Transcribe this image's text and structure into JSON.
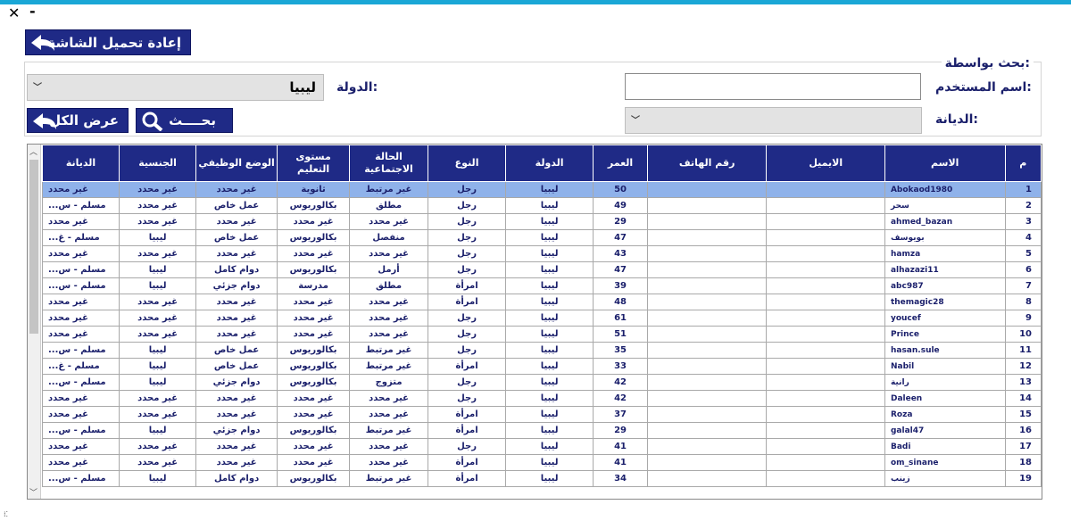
{
  "window": {
    "close_glyph": "✕",
    "minimize_glyph": "-"
  },
  "toolbar": {
    "reload_label": "إعادة تحميل الشاشة",
    "reload_icon": "back-arrow-icon"
  },
  "search": {
    "group_title": "بحث بواسطة:",
    "username_label": "اسم المستخدم:",
    "username_value": "",
    "country_label": "الدولة:",
    "country_value": "ليبيا",
    "religion_label": "الديانة:",
    "religion_value": "",
    "search_button": "بحــــث",
    "search_icon": "magnifier-icon",
    "show_all_button": "عرض الكل",
    "show_all_icon": "back-arrow-icon"
  },
  "grid": {
    "columns": [
      "م",
      "الاسم",
      "الايميل",
      "رقم الهاتف",
      "العمر",
      "الدولة",
      "النوع",
      "الحالة الاجتماعية",
      "مستوى التعليم",
      "الوضع الوظيفي",
      "الجنسية",
      "الديانة"
    ],
    "rows": [
      [
        "1",
        "Abokaod1980",
        "",
        "",
        "50",
        "ليبيا",
        "رجل",
        "غير مرتبط",
        "ثانوية",
        "غير محدد",
        "غير محدد",
        "غير محدد"
      ],
      [
        "2",
        "سحر",
        "",
        "",
        "49",
        "ليبيا",
        "رجل",
        "مطلق",
        "بكالوريوس",
        "عمل خاص",
        "غير محدد",
        "مسلم - س..."
      ],
      [
        "3",
        "ahmed_bazan",
        "",
        "",
        "29",
        "ليبيا",
        "رجل",
        "غير محدد",
        "غير محدد",
        "غير محدد",
        "غير محدد",
        "غير محدد"
      ],
      [
        "4",
        "بويوسف",
        "",
        "",
        "47",
        "ليبيا",
        "رجل",
        "منفصل",
        "بكالوريوس",
        "عمل خاص",
        "ليبيا",
        "مسلم - غ..."
      ],
      [
        "5",
        "hamza",
        "",
        "",
        "43",
        "ليبيا",
        "رجل",
        "غير محدد",
        "غير محدد",
        "غير محدد",
        "غير محدد",
        "غير محدد"
      ],
      [
        "6",
        "alhazazi11",
        "",
        "",
        "47",
        "ليبيا",
        "رجل",
        "أرمل",
        "بكالوريوس",
        "دوام كامل",
        "ليبيا",
        "مسلم - س..."
      ],
      [
        "7",
        "abc987",
        "",
        "",
        "39",
        "ليبيا",
        "امرأة",
        "مطلق",
        "مدرسة",
        "دوام جزئي",
        "ليبيا",
        "مسلم - س..."
      ],
      [
        "8",
        "themagic28",
        "",
        "",
        "48",
        "ليبيا",
        "امرأة",
        "غير محدد",
        "غير محدد",
        "غير محدد",
        "غير محدد",
        "غير محدد"
      ],
      [
        "9",
        "youcef",
        "",
        "",
        "61",
        "ليبيا",
        "رجل",
        "غير محدد",
        "غير محدد",
        "غير محدد",
        "غير محدد",
        "غير محدد"
      ],
      [
        "10",
        "Prince",
        "",
        "",
        "51",
        "ليبيا",
        "رجل",
        "غير محدد",
        "غير محدد",
        "غير محدد",
        "غير محدد",
        "غير محدد"
      ],
      [
        "11",
        "hasan.sule",
        "",
        "",
        "35",
        "ليبيا",
        "رجل",
        "غير مرتبط",
        "بكالوريوس",
        "عمل خاص",
        "ليبيا",
        "مسلم - س..."
      ],
      [
        "12",
        "Nabil",
        "",
        "",
        "33",
        "ليبيا",
        "امرأة",
        "غير مرتبط",
        "بكالوريوس",
        "عمل خاص",
        "ليبيا",
        "مسلم - غ..."
      ],
      [
        "13",
        "رانية",
        "",
        "",
        "42",
        "ليبيا",
        "رجل",
        "متزوج",
        "بكالوريوس",
        "دوام جزئي",
        "ليبيا",
        "مسلم - س..."
      ],
      [
        "14",
        "Daleen",
        "",
        "",
        "42",
        "ليبيا",
        "رجل",
        "غير محدد",
        "غير محدد",
        "غير محدد",
        "غير محدد",
        "غير محدد"
      ],
      [
        "15",
        "Roza",
        "",
        "",
        "37",
        "ليبيا",
        "امرأة",
        "غير محدد",
        "غير محدد",
        "غير محدد",
        "غير محدد",
        "غير محدد"
      ],
      [
        "16",
        "galal47",
        "",
        "",
        "29",
        "ليبيا",
        "امرأة",
        "غير مرتبط",
        "بكالوريوس",
        "دوام جزئي",
        "ليبيا",
        "مسلم - س..."
      ],
      [
        "17",
        "Badi",
        "",
        "",
        "41",
        "ليبيا",
        "رجل",
        "غير محدد",
        "غير محدد",
        "غير محدد",
        "غير محدد",
        "غير محدد"
      ],
      [
        "18",
        "om_sinane",
        "",
        "",
        "41",
        "ليبيا",
        "امرأة",
        "غير محدد",
        "غير محدد",
        "غير محدد",
        "غير محدد",
        "غير محدد"
      ],
      [
        "19",
        "زينب",
        "",
        "",
        "34",
        "ليبيا",
        "امرأة",
        "غير مرتبط",
        "بكالوريوس",
        "دوام كامل",
        "ليبيا",
        "مسلم - س..."
      ]
    ],
    "selected_row": 0
  },
  "colors": {
    "accent": "#1f2a86",
    "selection": "#8fb2ea",
    "topbar": "#1aa7d6"
  }
}
